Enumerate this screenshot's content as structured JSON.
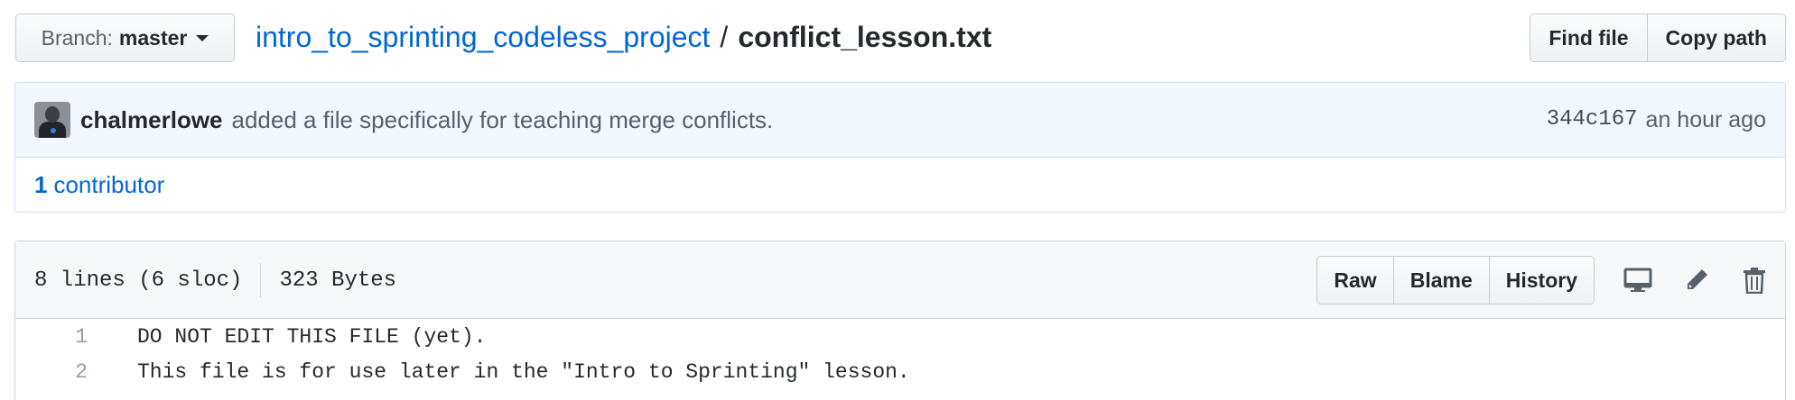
{
  "branch": {
    "label": "Branch:",
    "name": "master"
  },
  "breadcrumb": {
    "repo": "intro_to_sprinting_codeless_project",
    "separator": "/",
    "file": "conflict_lesson.txt"
  },
  "path_actions": {
    "find_file": "Find file",
    "copy_path": "Copy path"
  },
  "commit": {
    "author": "chalmerlowe",
    "message": "added a file specifically for teaching merge conflicts.",
    "sha": "344c167",
    "time": "an hour ago"
  },
  "contributors": {
    "count": "1",
    "label": "contributor"
  },
  "file": {
    "lines_info": "8 lines (6 sloc)",
    "size": "323 Bytes",
    "actions": {
      "raw": "Raw",
      "blame": "Blame",
      "history": "History"
    },
    "icons": [
      "desktop-icon",
      "pencil-icon",
      "trash-icon"
    ],
    "lines": [
      {
        "num": "1",
        "code": "DO NOT EDIT THIS FILE (yet)."
      },
      {
        "num": "2",
        "code": "This file is for use later in the \"Intro to Sprinting\" lesson."
      }
    ]
  },
  "colors": {
    "link": "#0366d6",
    "commit_bg": "#f1f8ff",
    "commit_border": "#c8e1ff",
    "header_bg": "#f6f8fa"
  }
}
